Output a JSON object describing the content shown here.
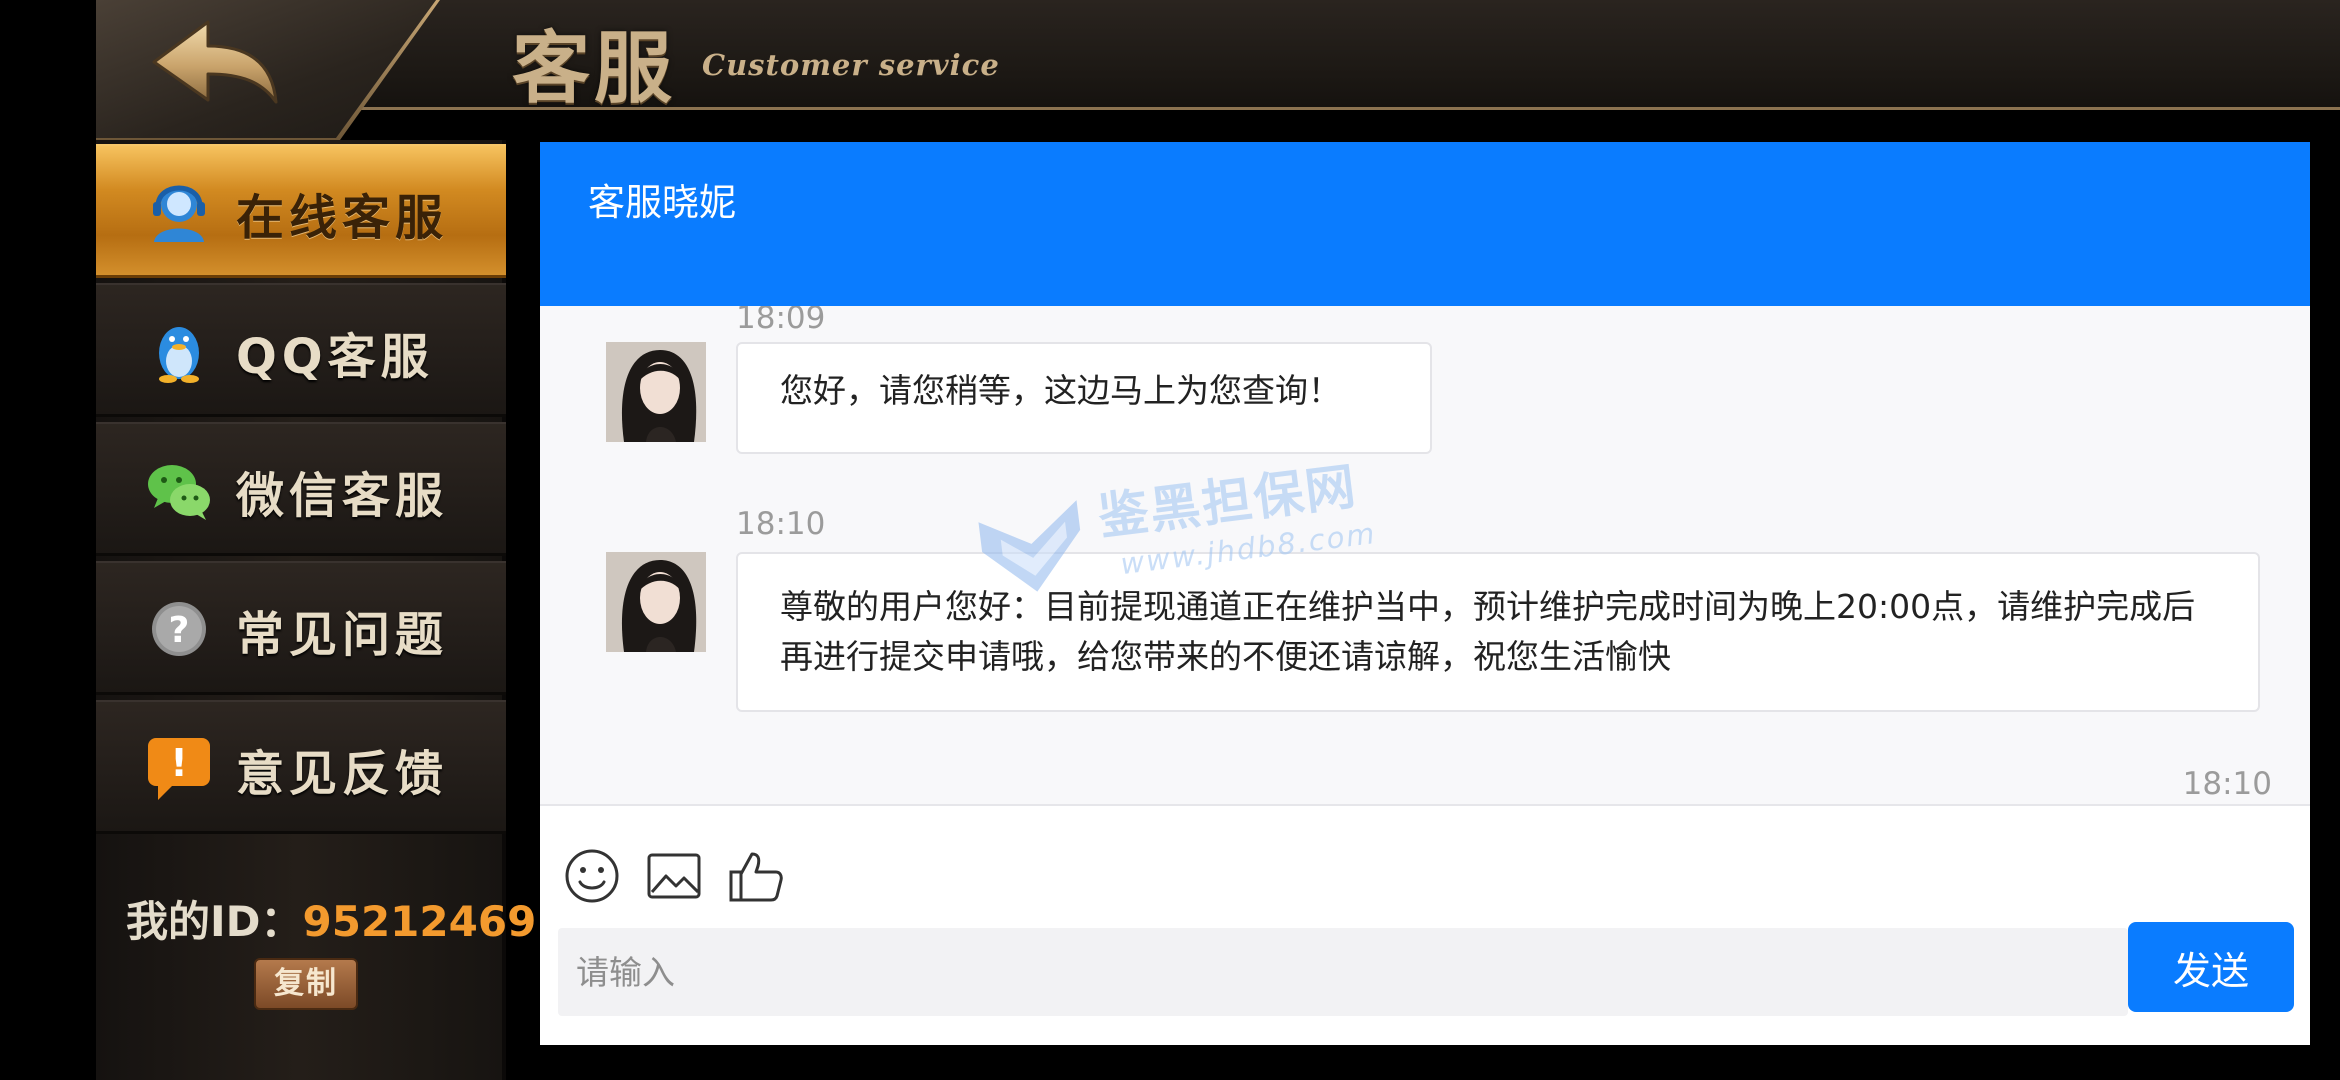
{
  "header": {
    "title_cn": "客服",
    "title_en": "Customer service",
    "back_icon": "back-arrow-icon",
    "accent": "#c9b089"
  },
  "sidebar": {
    "items": [
      {
        "label": "在线客服",
        "icon": "headset-agent-icon",
        "active": true
      },
      {
        "label": "QQ客服",
        "icon": "qq-penguin-icon",
        "active": false
      },
      {
        "label": "微信客服",
        "icon": "wechat-icon",
        "active": false
      },
      {
        "label": "常见问题",
        "icon": "question-mark-icon",
        "active": false
      },
      {
        "label": "意见反馈",
        "icon": "exclamation-bubble-icon",
        "active": false
      }
    ],
    "user_id_label": "我的ID：",
    "user_id_value": "95212469",
    "copy_label": "复制",
    "active_color": "#d28a21",
    "id_color": "#f39a2e"
  },
  "chat": {
    "title": "客服晓妮",
    "header_color": "#0a7cff",
    "messages": [
      {
        "time": "18:09",
        "text": "您好，请您稍等，这边马上为您查询！"
      },
      {
        "time": "18:10",
        "text": "尊敬的用户您好：目前提现通道正在维护当中，预计维护完成时间为晚上20:00点，请维护完成后再进行提交申请哦，给您带来的不便还请谅解，祝您生活愉快"
      }
    ],
    "trailing_time": "18:10",
    "toolbar": {
      "icons": [
        "emoji-icon",
        "image-icon",
        "thumbs-up-icon"
      ]
    },
    "input_placeholder": "请输入",
    "send_label": "发送"
  },
  "watermark": {
    "text": "鉴黑担保网",
    "url": "www.jhdb8.com"
  }
}
